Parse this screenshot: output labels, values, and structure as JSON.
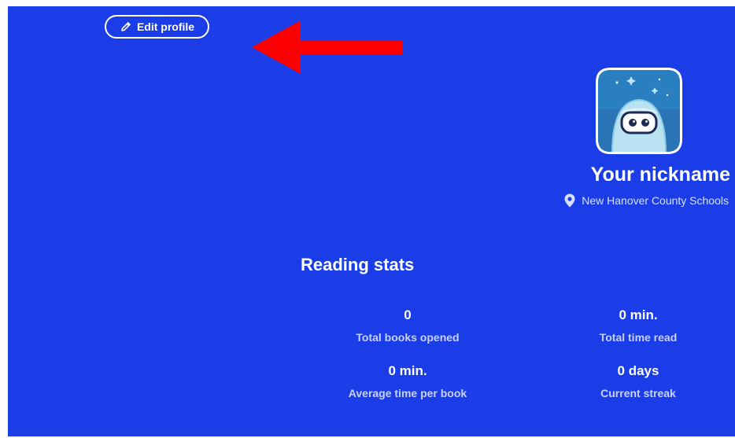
{
  "header": {
    "edit_profile_label": "Edit profile"
  },
  "profile": {
    "nickname": "Your nickname",
    "location": "New Hanover County Schools",
    "avatar_icon": "robot-astronaut-avatar"
  },
  "reading_stats": {
    "title": "Reading stats",
    "items": [
      {
        "value": "0",
        "label": "Total books opened"
      },
      {
        "value": "0 min.",
        "label": "Total time read"
      },
      {
        "value": "0 min.",
        "label": "Average time per book"
      },
      {
        "value": "0 days",
        "label": "Current streak"
      }
    ]
  },
  "colors": {
    "background": "#1a3de8",
    "arrow": "#ff0000",
    "text": "#ffffff",
    "muted_text": "#c9d2ff"
  },
  "icons": {
    "edit": "pencil-icon",
    "location": "map-pin-icon",
    "annotation": "red-arrow-icon"
  }
}
